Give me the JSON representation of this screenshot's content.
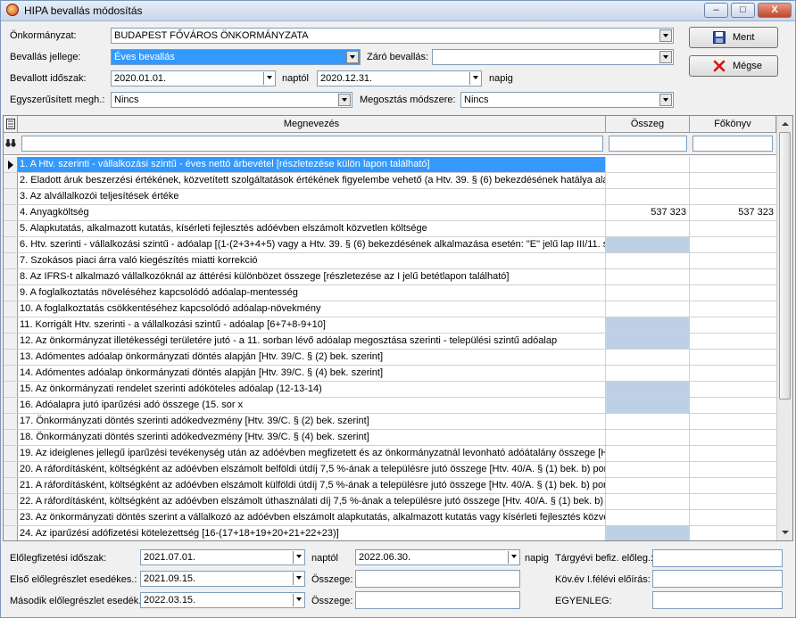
{
  "window": {
    "title": "HIPA bevallás módosítás",
    "minimize": "–",
    "maximize": "□",
    "close": "X"
  },
  "form": {
    "onkormanyzat_label": "Önkormányzat:",
    "onkormanyzat_value": "BUDAPEST FŐVÁROS ÖNKORMÁNYZATA",
    "jelleg_label": "Bevallás jellege:",
    "jelleg_value": "Éves bevallás",
    "zaro_label": "Záró bevallás:",
    "zaro_value": "",
    "idoszak_label": "Bevallott időszak:",
    "idoszak_from": "2020.01.01.",
    "idoszak_from_suffix": "naptól",
    "idoszak_to": "2020.12.31.",
    "idoszak_to_suffix": "napig",
    "egyszerusitett_label": "Egyszerűsített megh.:",
    "egyszerusitett_value": "Nincs",
    "megosztas_label": "Megosztás módszere:",
    "megosztas_value": "Nincs"
  },
  "buttons": {
    "save": "Ment",
    "cancel": "Mégse"
  },
  "grid": {
    "headers": {
      "name": "Megnevezés",
      "col1": "Összeg",
      "col2": "Főkönyv"
    },
    "rows": [
      {
        "name": "1. A Htv. szerinti - vállalkozási szintű - éves nettó árbevétel [részletezése külön lapon található]",
        "col1": "",
        "col2": ""
      },
      {
        "name": "2. Eladott áruk beszerzési értékének, közvetített szolgáltatások értékének figyelembe vehető (a Htv. 39. § (6) bekezdésének hatálya alá nem",
        "col1": "",
        "col2": ""
      },
      {
        "name": "3. Az alvállalkozói teljesítések értéke",
        "col1": "",
        "col2": ""
      },
      {
        "name": "4. Anyagköltség",
        "col1": "537 323",
        "col2": "537 323"
      },
      {
        "name": "5. Alapkutatás, alkalmazott kutatás, kísérleti fejlesztés adóévben elszámolt közvetlen költsége",
        "col1": "",
        "col2": ""
      },
      {
        "name": "6. Htv. szerinti - vállalkozási szintű - adóalap [(1-(2+3+4+5) vagy a Htv. 39. § (6) bekezdésének alkalmazása esetén: \"E\" jelű lap III/11. sor]",
        "col1": "",
        "col2": ""
      },
      {
        "name": "7. Szokásos piaci árra való kiegészítés miatti korrekció",
        "col1": "",
        "col2": ""
      },
      {
        "name": "8. Az IFRS-t alkalmazó vállalkozóknál az áttérési különbözet összege [részletezése az I jelű betétlapon található]",
        "col1": "",
        "col2": ""
      },
      {
        "name": "9. A foglalkoztatás növeléséhez kapcsolódó adóalap-mentesség",
        "col1": "",
        "col2": ""
      },
      {
        "name": "10. A foglalkoztatás csökkentéséhez kapcsolódó adóalap-növekmény",
        "col1": "",
        "col2": ""
      },
      {
        "name": "11. Korrigált Htv. szerinti - a vállalkozási szintű - adóalap [6+7+8-9+10]",
        "col1": "",
        "col2": ""
      },
      {
        "name": "12. Az önkormányzat illetékességi területére jutó - a 11. sorban lévő adóalap megosztása szerinti - települési szintű adóalap",
        "col1": "",
        "col2": ""
      },
      {
        "name": "13. Adómentes adóalap önkormányzati döntés alapján [Htv. 39/C. § (2) bek. szerint]",
        "col1": "",
        "col2": ""
      },
      {
        "name": "14. Adómentes adóalap önkormányzati döntés alapján [Htv. 39/C. § (4) bek. szerint]",
        "col1": "",
        "col2": ""
      },
      {
        "name": "15. Az önkormányzati rendelet szerinti adóköteles adóalap (12-13-14)",
        "col1": "",
        "col2": ""
      },
      {
        "name": "16. Adóalapra jutó iparűzési adó összege (15. sor x",
        "col1": "",
        "col2": ""
      },
      {
        "name": "17. Önkormányzati döntés szerinti adókedvezmény [Htv. 39/C. § (2) bek. szerint]",
        "col1": "",
        "col2": ""
      },
      {
        "name": "18. Önkormányzati döntés szerinti adókedvezmény [Htv. 39/C. § (4) bek. szerint]",
        "col1": "",
        "col2": ""
      },
      {
        "name": "19. Az ideiglenes jellegű iparűzési tevékenység után az adóévben megfizetett és az önkormányzatnál levonható adóátalány összege [Htv. 4",
        "col1": "",
        "col2": ""
      },
      {
        "name": "20. A ráfordításként, költségként az adóévben elszámolt belföldi útdíj 7,5 %-ának a településre jutó összege [Htv. 40/A. § (1) bek. b) pontja",
        "col1": "",
        "col2": ""
      },
      {
        "name": "21. A ráfordításként, költségként az adóévben elszámolt külföldi útdíj 7,5 %-ának a településre jutó összege [Htv. 40/A. § (1) bek. b) pontja",
        "col1": "",
        "col2": ""
      },
      {
        "name": "22. A ráfordításként, költségként az adóévben elszámolt úthasználati díj 7,5 %-ának a településre jutó összege [Htv. 40/A. § (1) bek. b) pon",
        "col1": "",
        "col2": ""
      },
      {
        "name": "23. Az önkormányzati döntés szerint a vállalkozó az adóévben elszámolt alapkutatás, alkalmazott kutatás vagy kísérleti fejlesztés közvetlen",
        "col1": "",
        "col2": ""
      },
      {
        "name": "24. Az iparűzési adófizetési kötelezettség [16-(17+18+19+20+21+22+23)]",
        "col1": "",
        "col2": ""
      }
    ]
  },
  "footer": {
    "eloleg_idoszak_label": "Előlegfizetési időszak:",
    "eloleg_from": "2021.07.01.",
    "eloleg_from_suffix": "naptól",
    "eloleg_to": "2022.06.30.",
    "eloleg_to_suffix": "napig",
    "targyevi_label": "Tárgyévi befiz. előleg.:",
    "targyevi_value": "",
    "elso_label": "Első előlegrészlet esedékes.:",
    "elso_value": "2021.09.15.",
    "elso_osszeg_label": "Összege:",
    "elso_osszeg_value": "",
    "kov_label": "Köv.év I.félévi előírás:",
    "kov_value": "",
    "masodik_label": "Második előlegrészlet esedék.:",
    "masodik_value": "2022.03.15.",
    "masodik_osszeg_label": "Összege:",
    "masodik_osszeg_value": "",
    "egyenleg_label": "EGYENLEG:",
    "egyenleg_value": ""
  }
}
